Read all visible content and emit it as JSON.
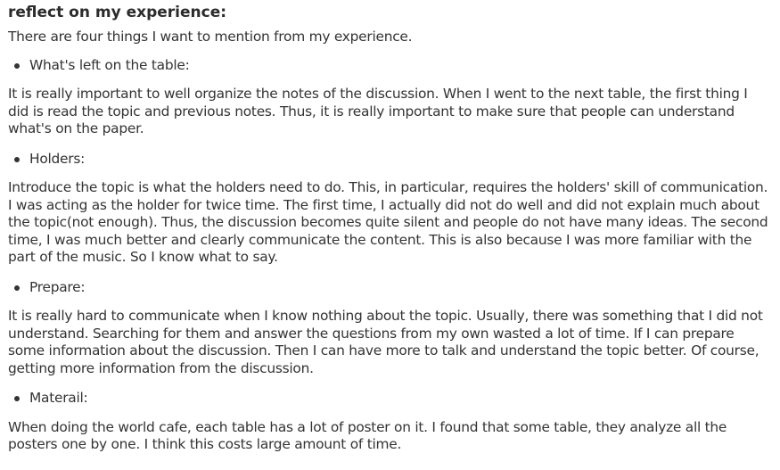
{
  "heading": "reflect on my experience:",
  "intro": "There are four things I want to mention from my experience.",
  "sections": [
    {
      "bullet": "What's left on the table:",
      "paragraph": "It is really important to well organize the notes of the discussion. When I went to the next table, the first thing I did is read the topic and previous notes. Thus, it is really important to make sure that people can understand what's on the paper."
    },
    {
      "bullet": "Holders:",
      "paragraph": "Introduce the topic is what the holders need to do. This, in particular, requires the holders' skill of communication. I was acting as the holder for twice time. The first time, I actually did not do well and did not explain much about the topic(not enough). Thus, the discussion becomes quite silent and people do not have many ideas. The second time, I was much better and clearly communicate the content. This is also because I was more familiar with the part of the music. So I know what to say."
    },
    {
      "bullet": "Prepare:",
      "paragraph": "It is really hard to communicate when I know nothing about the topic. Usually, there was something that I did not understand. Searching for them and answer the questions from my own wasted a lot of time. If I can prepare some information about the discussion. Then I can have more to talk and understand the topic better. Of course, getting more information from the discussion."
    },
    {
      "bullet": "Materail:",
      "paragraph": "When doing the world cafe, each table has a lot of poster on it. I found that some table, they analyze all the posters one by one. I think this costs large amount of time."
    }
  ]
}
